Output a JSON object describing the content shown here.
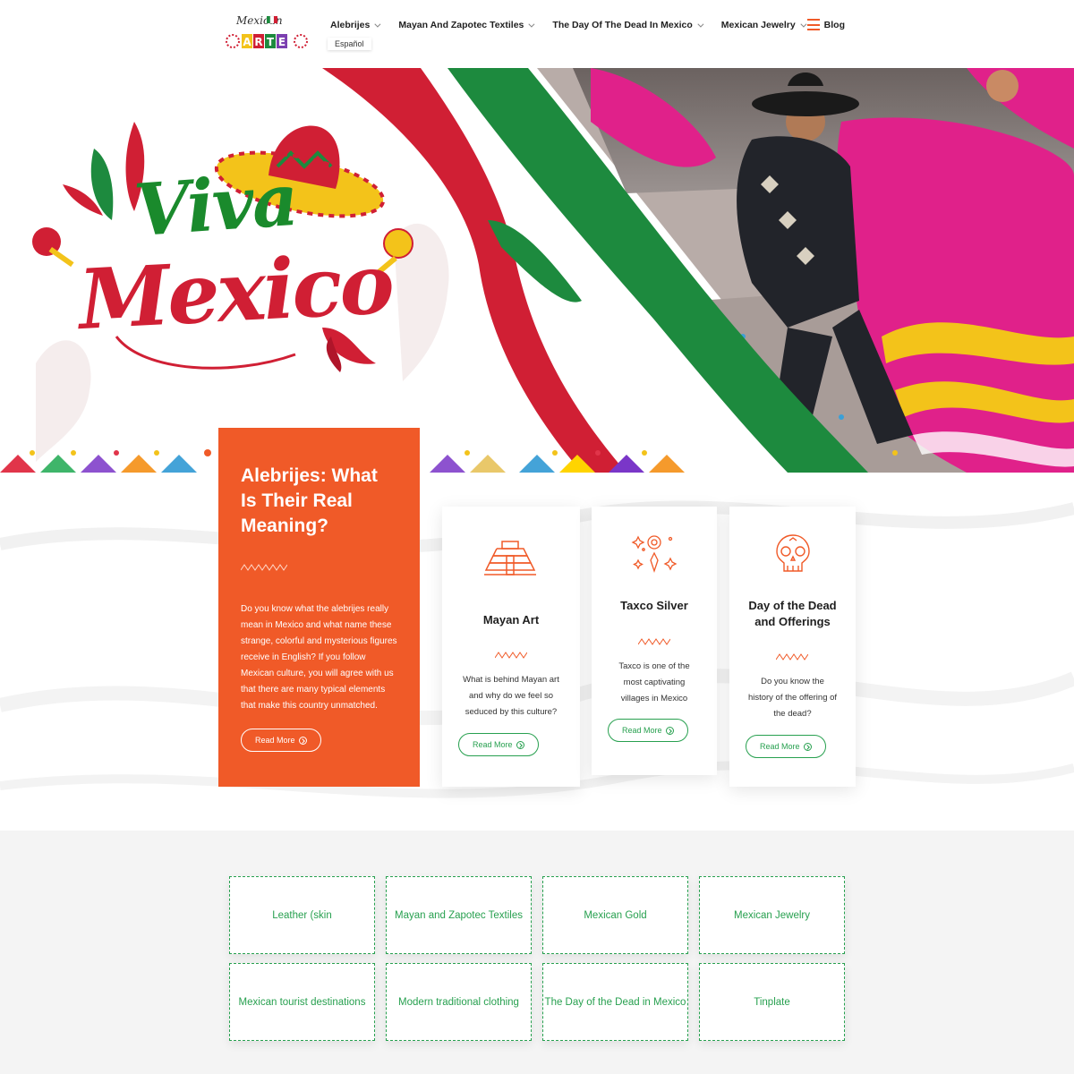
{
  "header": {
    "logo": {
      "script": "Mexican",
      "word": "ARTE"
    },
    "nav": [
      {
        "label": "Alebrijes",
        "has_dropdown": true
      },
      {
        "label": "Mayan And Zapotec Textiles",
        "has_dropdown": true
      },
      {
        "label": "The Day Of The Dead In Mexico",
        "has_dropdown": true
      },
      {
        "label": "Mexican Jewelry",
        "has_dropdown": true
      },
      {
        "label": "Blog",
        "has_dropdown": false
      }
    ],
    "language": "Español",
    "menu_icon": "hamburger-icon"
  },
  "hero": {
    "title_line1": "Viva",
    "title_line2": "Mexico"
  },
  "feature": {
    "title": "Alebrijes: What Is Their Real Meaning?",
    "text": "Do you know what the alebrijes really mean in Mexico and what name these strange, colorful and mysterious figures receive in English? If you follow Mexican culture, you will agree with us that there are many typical elements that make this country unmatched.",
    "button": "Read More"
  },
  "cards": [
    {
      "icon": "pyramid-icon",
      "title": "Mayan Art",
      "text": "What is behind Mayan art and why do we feel so seduced by this culture?",
      "button": "Read More"
    },
    {
      "icon": "sparkle-jewel-icon",
      "title": "Taxco Silver",
      "text": "Taxco is one of the most captivating villages in Mexico",
      "button": "Read More"
    },
    {
      "icon": "sugar-skull-icon",
      "title": "Day of the Dead and Offerings",
      "text": "Do you know the history of the offering of the dead?",
      "button": "Read More"
    }
  ],
  "categories": [
    "Leather (skin",
    "Mayan and Zapotec Textiles",
    "Mexican Gold",
    "Mexican Jewelry",
    "Mexican tourist destinations",
    "Modern traditional clothing",
    "The Day of the Dead in Mexico",
    "Tinplate"
  ],
  "colors": {
    "accent_orange": "#f05a28",
    "accent_green": "#27a04f",
    "flag_green": "#1d8a3e",
    "flag_red": "#d01f34"
  }
}
